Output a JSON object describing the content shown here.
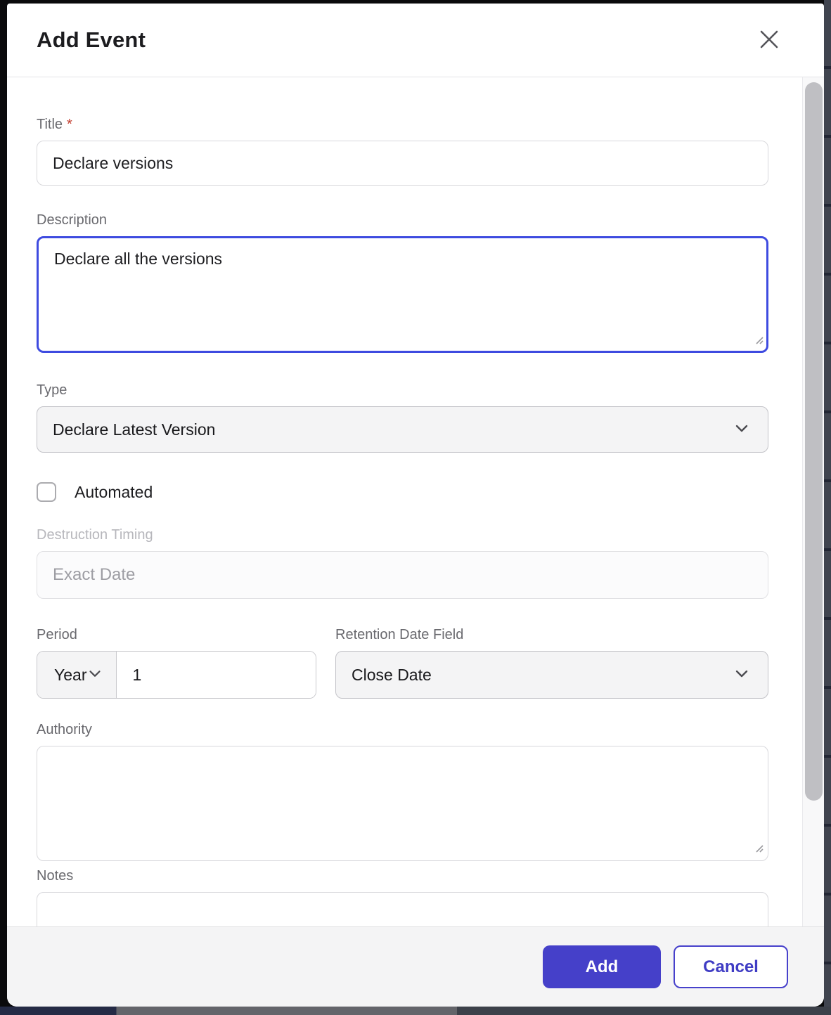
{
  "modal": {
    "title": "Add Event"
  },
  "fields": {
    "title": {
      "label": "Title",
      "required_marker": "*",
      "value": "Declare versions"
    },
    "description": {
      "label": "Description",
      "value": "Declare all the versions"
    },
    "type": {
      "label": "Type",
      "value": "Declare Latest Version"
    },
    "automated": {
      "label": "Automated",
      "checked": false
    },
    "destruction_timing": {
      "label": "Destruction Timing",
      "placeholder": "Exact Date",
      "disabled": true
    },
    "period": {
      "label": "Period",
      "unit_value": "Year",
      "amount_value": "1"
    },
    "retention_date_field": {
      "label": "Retention Date Field",
      "value": "Close Date"
    },
    "authority": {
      "label": "Authority",
      "value": ""
    },
    "notes": {
      "label": "Notes",
      "value": ""
    }
  },
  "footer": {
    "add_label": "Add",
    "cancel_label": "Cancel"
  },
  "colors": {
    "accent": "#4540c9",
    "focus_border": "#3e4be0",
    "required": "#c23a2b"
  }
}
